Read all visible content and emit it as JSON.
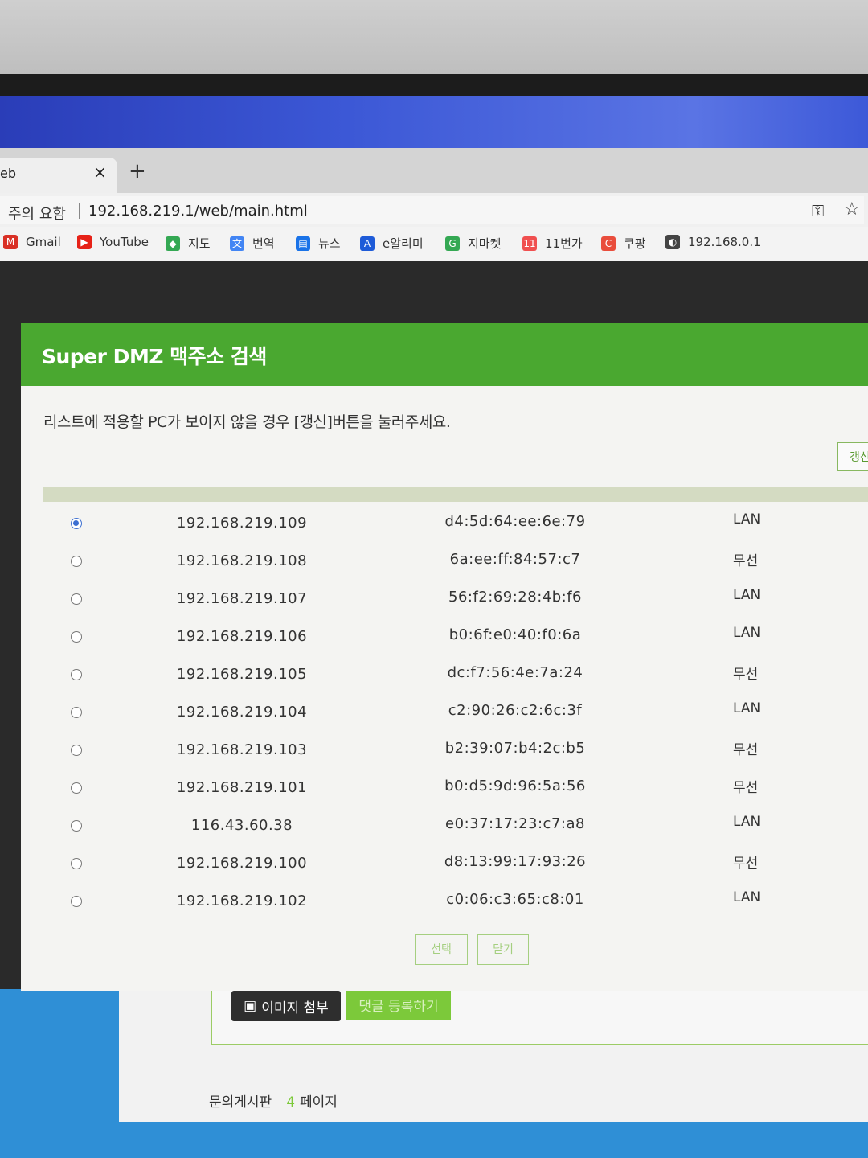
{
  "browser": {
    "tab_title": "eb",
    "tab_close": "×",
    "new_tab": "+",
    "security_label": "주의 요함",
    "url": "192.168.219.1/web/main.html",
    "key_icon": "key-icon",
    "star_icon": "star-icon",
    "bookmarks": [
      {
        "label": "Gmail",
        "icon": "gmail-icon",
        "color": "#d93025",
        "glyph": "M"
      },
      {
        "label": "YouTube",
        "icon": "youtube-icon",
        "color": "#e62117",
        "glyph": "▶"
      },
      {
        "label": "지도",
        "icon": "maps-icon",
        "color": "#34a853",
        "glyph": "◆"
      },
      {
        "label": "번역",
        "icon": "translate-icon",
        "color": "#4285f4",
        "glyph": "文"
      },
      {
        "label": "뉴스",
        "icon": "news-icon",
        "color": "#1a73e8",
        "glyph": "▤"
      },
      {
        "label": "e알리미",
        "icon": "ealimi-icon",
        "color": "#1e5bd8",
        "glyph": "A"
      },
      {
        "label": "지마켓",
        "icon": "gmarket-icon",
        "color": "#34a853",
        "glyph": "G"
      },
      {
        "label": "11번가",
        "icon": "11st-icon",
        "color": "#f04f4f",
        "glyph": "11"
      },
      {
        "label": "쿠팡",
        "icon": "coupang-icon",
        "color": "#e94d3c",
        "glyph": "C"
      },
      {
        "label": "192.168.0.1",
        "icon": "globe-icon",
        "color": "#444444",
        "glyph": "◐"
      }
    ]
  },
  "modal": {
    "title": "Super DMZ 맥주소 검색",
    "info": "리스트에 적용할 PC가 보이지 않을 경우 [갱신]버튼을 눌러주세요.",
    "refresh_label": "갱신",
    "rows": [
      {
        "ip": "192.168.219.109",
        "mac": "d4:5d:64:ee:6e:79",
        "type": "LAN",
        "selected": true
      },
      {
        "ip": "192.168.219.108",
        "mac": "6a:ee:ff:84:57:c7",
        "type": "무선",
        "selected": false
      },
      {
        "ip": "192.168.219.107",
        "mac": "56:f2:69:28:4b:f6",
        "type": "LAN",
        "selected": false
      },
      {
        "ip": "192.168.219.106",
        "mac": "b0:6f:e0:40:f0:6a",
        "type": "LAN",
        "selected": false
      },
      {
        "ip": "192.168.219.105",
        "mac": "dc:f7:56:4e:7a:24",
        "type": "무선",
        "selected": false
      },
      {
        "ip": "192.168.219.104",
        "mac": "c2:90:26:c2:6c:3f",
        "type": "LAN",
        "selected": false
      },
      {
        "ip": "192.168.219.103",
        "mac": "b2:39:07:b4:2c:b5",
        "type": "무선",
        "selected": false
      },
      {
        "ip": "192.168.219.101",
        "mac": "b0:d5:9d:96:5a:56",
        "type": "무선",
        "selected": false
      },
      {
        "ip": "116.43.60.38",
        "mac": "e0:37:17:23:c7:a8",
        "type": "LAN",
        "selected": false
      },
      {
        "ip": "192.168.219.100",
        "mac": "d8:13:99:17:93:26",
        "type": "무선",
        "selected": false
      },
      {
        "ip": "192.168.219.102",
        "mac": "c0:06:c3:65:c8:01",
        "type": "LAN",
        "selected": false
      }
    ],
    "select_label": "선택",
    "close_label": "닫기"
  },
  "page": {
    "image_attach_label": "이미지 첨부",
    "comment_submit_label": "댓글 등록하기",
    "board_label": "문의게시판",
    "page_num": "4",
    "page_suffix": "페이지"
  },
  "colors": {
    "modal_header": "#4aa830",
    "accent_green": "#7cc93a",
    "radio_selected": "#3c6fd1"
  }
}
